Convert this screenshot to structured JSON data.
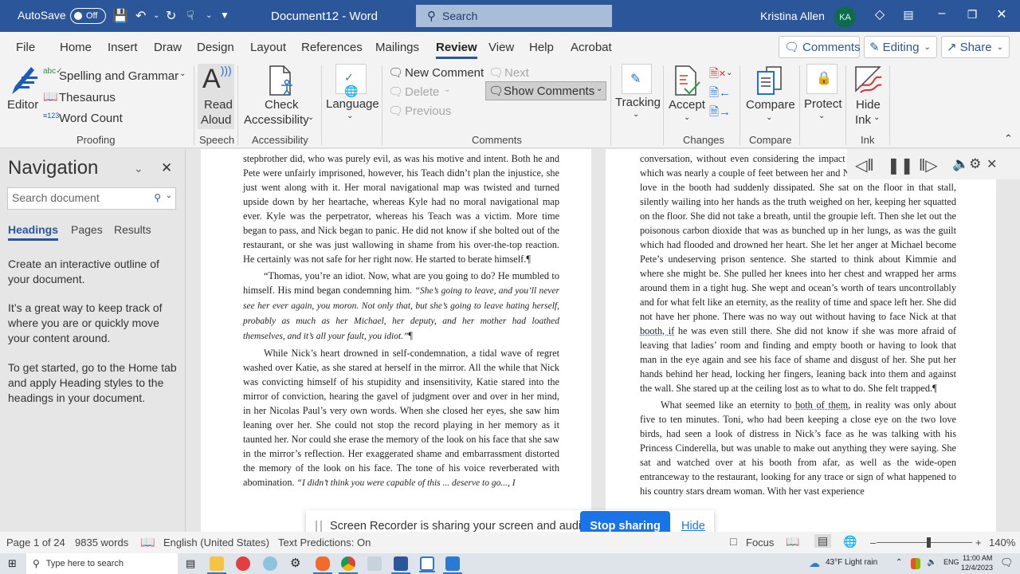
{
  "titlebar": {
    "autosave_label": "AutoSave",
    "autosave_state": "Off",
    "document_title": "Document12  -  Word",
    "search_placeholder": "Search",
    "user_name": "Kristina Allen",
    "user_initials": "KA"
  },
  "tabs": [
    "File",
    "Home",
    "Insert",
    "Draw",
    "Design",
    "Layout",
    "References",
    "Mailings",
    "Review",
    "View",
    "Help",
    "Acrobat"
  ],
  "active_tab": "Review",
  "top_buttons": {
    "comments": "Comments",
    "editing": "Editing",
    "share": "Share"
  },
  "ribbon": {
    "proofing": {
      "editor": "Editor",
      "spelling": "Spelling and Grammar",
      "thesaurus": "Thesaurus",
      "word_count": "Word Count",
      "label": "Proofing"
    },
    "speech": {
      "read": "Read",
      "aloud": "Aloud",
      "label": "Speech"
    },
    "accessibility": {
      "check": "Check",
      "accessibility": "Accessibility",
      "label": "Accessibility"
    },
    "language": {
      "language": "Language"
    },
    "comments": {
      "new_comment": "New Comment",
      "next": "Next",
      "delete": "Delete",
      "show_comments": "Show Comments",
      "previous": "Previous",
      "label": "Comments"
    },
    "tracking": {
      "tracking": "Tracking"
    },
    "changes": {
      "accept": "Accept",
      "label": "Changes"
    },
    "compare": {
      "compare": "Compare",
      "label": "Compare"
    },
    "protect": {
      "protect": "Protect"
    },
    "ink": {
      "hide": "Hide",
      "ink": "Ink",
      "label": "Ink"
    }
  },
  "navigation": {
    "title": "Navigation",
    "search_placeholder": "Search document",
    "tabs": [
      "Headings",
      "Pages",
      "Results"
    ],
    "active_tab": "Headings",
    "text1": "Create an interactive outline of your document.",
    "text2": "It’s a great way to keep track of where you are or quickly move your content around.",
    "text3": "To get started, go to the Home tab and apply Heading styles to the headings in your document."
  },
  "document": {
    "left_page": {
      "p1": "stepbrother did, who was purely evil, as was his motive and intent. Both he and Pete were unfairly imprisoned, however, his Teach didn’t plan the injustice, she just went along with it. Her moral navigational map was twisted and turned upside down by her heartache, whereas Kyle had no moral navigational map ever. Kyle was the perpetrator, whereas his Teach was a victim. More time began to pass, and Nick began to panic. He did not know if she bolted out of the restaurant, or she was just wallowing in shame from his over-the-top reaction. He certainly was not safe for her right now. He started to berate himself.¶",
      "p2_plain": "“Thomas, you’re an idiot. Now, what are you going to do? He mumbled to himself. His mind began condemning him. ",
      "p2_italic": "“She’s going to leave, and you’ll never see her ever again, you moron. Not only that, but she’s going to leave hating herself, probably as much as her Michael, her deputy, and her mother had loathed themselves, and it’s all your fault, you idiot.”",
      "p2_end": "¶",
      "p3_plain": "While Nick’s heart drowned in self-condemnation, a tidal wave of regret washed over Katie, as she stared at herself in the mirror. All the while that Nick was convicting himself of his stupidity and insensitivity, Katie stared into the mirror of conviction, hearing the gavel of judgment over and over in her mind, in her Nicolas Paul’s very own words. When she closed her eyes, she saw him leaning over her. She could not stop the record playing in her memory as it taunted her. Nor could she erase the memory of the look on his face that she saw in the mirror’s reflection. Her exaggerated shame and embarrassment distorted the memory of the look on his face. The tone of his voice reverberated with abomination. ",
      "p3_italic": "“I didn’t think you were capable of this ... deserve to go..., I"
    },
    "right_page": {
      "p1_a": "conversation, without even considering the impact of traveling that far away, which was nearly a couple of feet between her and Nick’s booth, where the new love in the booth had suddenly dissipated. She sat on the floor in that stall, silently wailing into her hands as the truth weighed on her, keeping her squatted on the floor. She did not take a breath, until the groupie left. Then she let out the poisonous carbon dioxide that was as bunched up in her lungs, as was the guilt which had flooded and drowned her heart. She let her anger at Michael become Pete’s undeserving prison sentence. She started to think about Kimmie and where she might be. She pulled her knees into her chest and wrapped her arms around them in a tight hug. She wept and ocean’s worth of tears uncontrollably and for what felt like an eternity, as the reality of time and space left her. She did not have her phone. There was no way out without having to face Nick at that ",
      "p1_squiggle": "booth, if",
      "p1_b": " he was even still there. She did not know if she was more afraid of leaving that ladies’ room and finding and empty booth or having to look that man in the eye again and see his face of shame and disgust of her. She put her hands behind her head, locking her fingers, leaning back into them and against the wall. She stared up at the ceiling lost as to what to do. She felt trapped.¶",
      "p2_a": "What seemed like an eternity to ",
      "p2_squiggle": "both of them",
      "p2_b": ", in reality was only about five to ten minutes. Toni, who had been keeping a close eye on the two love birds, had seen a look of distress in Nick’s face as he was talking with his Princess Cinderella, but was unable to make out anything they were saying. She sat and watched over at his booth from afar, as well as the wide-open entranceway to the restaurant, looking for any trace or sign of what happened to his country stars dream woman. With her vast experience"
    }
  },
  "recorder": {
    "message": "Screen Recorder is sharing your screen and audio.",
    "stop": "Stop sharing",
    "hide": "Hide"
  },
  "statusbar": {
    "page": "Page 1 of 24",
    "words": "9835 words",
    "language": "English (United States)",
    "text_predictions": "Text Predictions: On",
    "focus": "Focus",
    "zoom": "140%",
    "zoom_percent": 140
  },
  "taskbar": {
    "search_placeholder": "Type here to search",
    "weather": "43°F  Light rain",
    "lang": "ENG",
    "time": "11:00 AM",
    "date": "12/4/2023"
  },
  "colors": {
    "accent": "#2b579a",
    "share_blue": "#1a73e8"
  }
}
